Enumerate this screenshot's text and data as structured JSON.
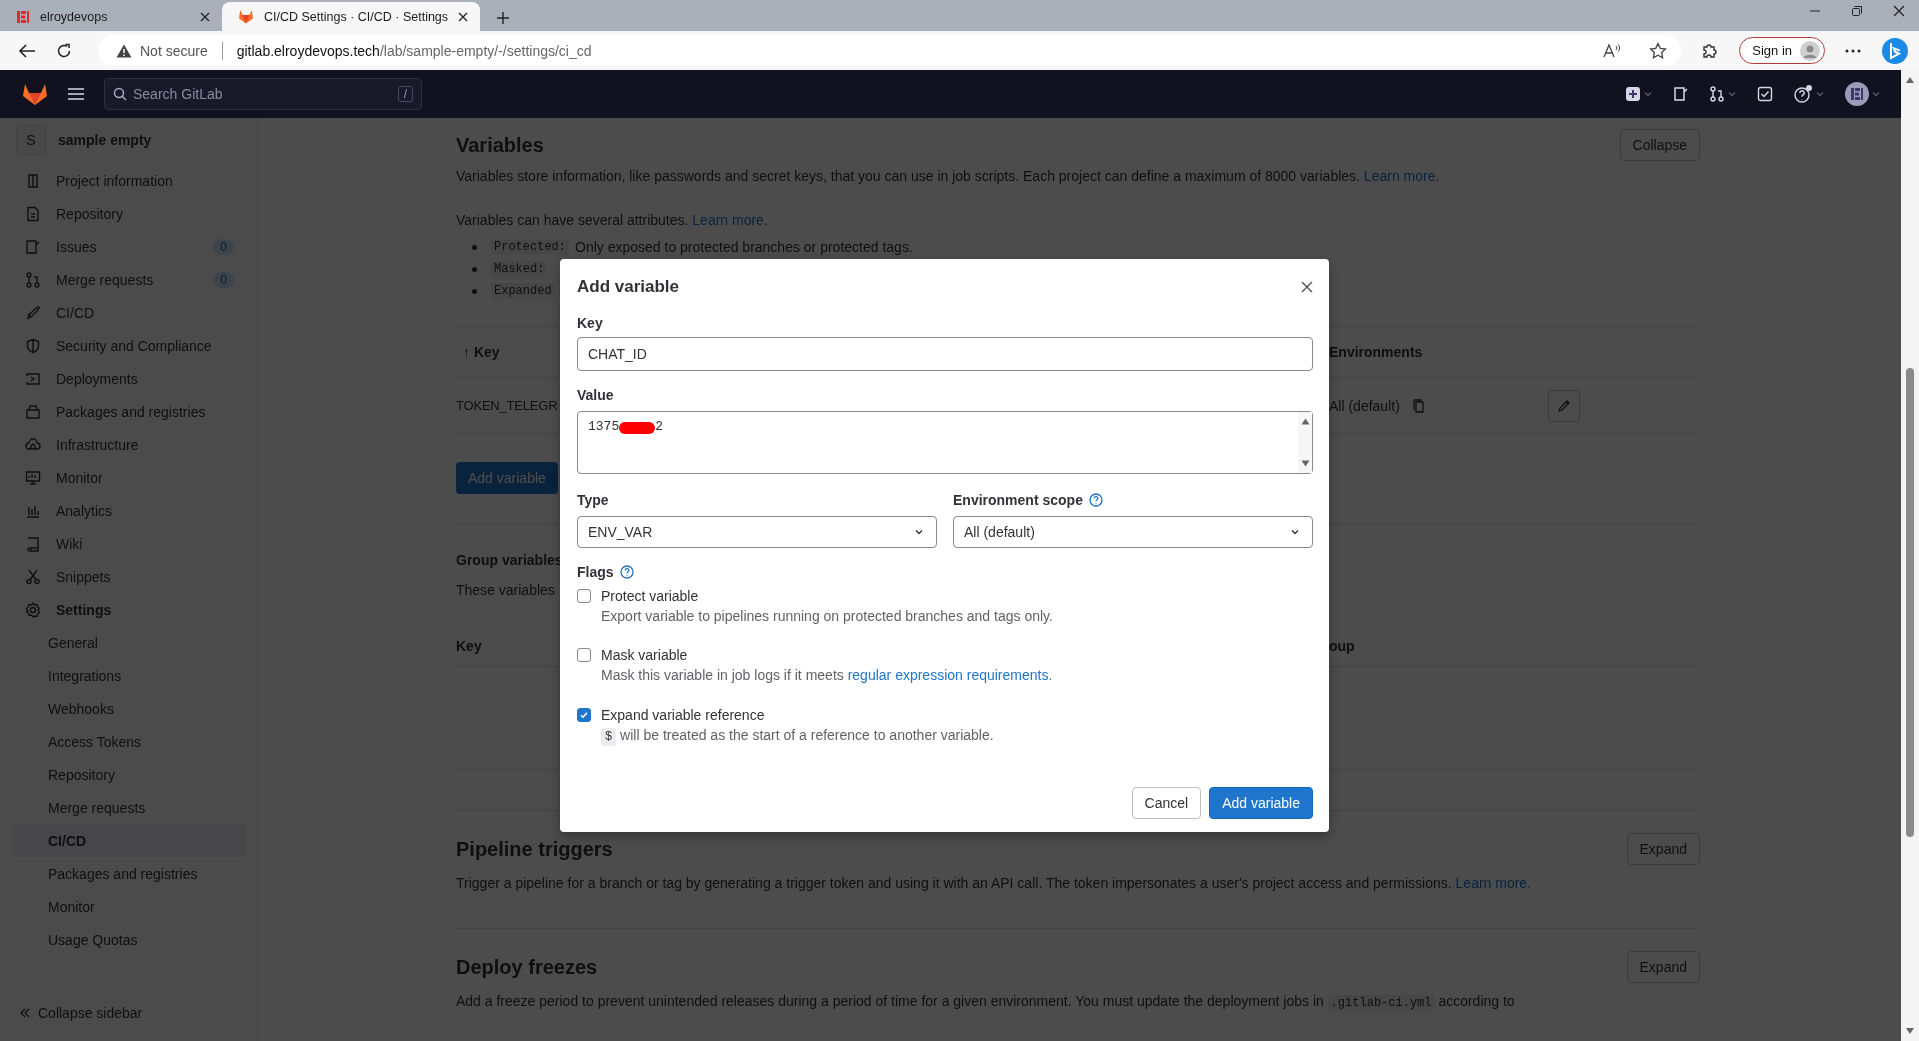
{
  "browser": {
    "tabs": [
      {
        "title": "elroydevops",
        "selected": false
      },
      {
        "title": "CI/CD Settings · CI/CD · Settings",
        "selected": true
      }
    ],
    "security": "Not secure",
    "url_host": "gitlab.elroydevops.tech",
    "url_path": "/lab/sample-empty/-/settings/ci_cd",
    "sign_in": "Sign in"
  },
  "topbar": {
    "search_placeholder": "Search GitLab",
    "search_shortcut": "/"
  },
  "sidebar": {
    "project_initial": "S",
    "project_name": "sample empty",
    "items": [
      {
        "label": "Project information",
        "expanded": false
      },
      {
        "label": "Repository",
        "expanded": false
      },
      {
        "label": "Issues",
        "count": "0",
        "expanded": false
      },
      {
        "label": "Merge requests",
        "count": "0",
        "expanded": false
      },
      {
        "label": "CI/CD",
        "expanded": false
      },
      {
        "label": "Security and Compliance",
        "expanded": false
      },
      {
        "label": "Deployments",
        "expanded": false
      },
      {
        "label": "Packages and registries",
        "expanded": false
      },
      {
        "label": "Infrastructure",
        "expanded": false
      },
      {
        "label": "Monitor",
        "expanded": false
      },
      {
        "label": "Analytics",
        "expanded": false
      },
      {
        "label": "Wiki",
        "expanded": false
      },
      {
        "label": "Snippets",
        "expanded": false
      },
      {
        "label": "Settings",
        "expanded": true,
        "children": [
          {
            "label": "General",
            "selected": false
          },
          {
            "label": "Integrations",
            "selected": false
          },
          {
            "label": "Webhooks",
            "selected": false
          },
          {
            "label": "Access Tokens",
            "selected": false
          },
          {
            "label": "Repository",
            "selected": false
          },
          {
            "label": "Merge requests",
            "selected": false
          },
          {
            "label": "CI/CD",
            "selected": true
          },
          {
            "label": "Packages and registries",
            "selected": false
          },
          {
            "label": "Monitor",
            "selected": false
          },
          {
            "label": "Usage Quotas",
            "selected": false
          }
        ]
      }
    ],
    "collapse_label": "Collapse sidebar"
  },
  "variables": {
    "title": "Variables",
    "button": "Collapse",
    "description": "Variables store information, like passwords and secret keys, that you can use in job scripts. Each project can define a maximum of 8000 variables.",
    "description_link": "Learn more.",
    "attributes_intro": "Variables can have several attributes.",
    "attributes_link": "Learn more.",
    "bullets": [
      {
        "code": "Protected:",
        "text": "Only exposed to protected branches or protected tags."
      },
      {
        "code": "Masked:"
      },
      {
        "code": "Expanded"
      }
    ],
    "columns": [
      "↑ Key",
      "Environments"
    ],
    "rows": [
      {
        "key": "TOKEN_TELEGR",
        "environment": "All (default)"
      }
    ],
    "add_button": "Add variable"
  },
  "group_variables": {
    "title": "Group variables",
    "description": "These variables",
    "columns": [
      "Key",
      "oup"
    ]
  },
  "pipeline_triggers": {
    "title": "Pipeline triggers",
    "button": "Expand",
    "description": "Trigger a pipeline for a branch or tag by generating a trigger token and using it with an API call. The token impersonates a user's project access and permissions.",
    "link": "Learn more."
  },
  "deploy_freezes": {
    "title": "Deploy freezes",
    "button": "Expand",
    "description_before": "Add a freeze period to prevent unintended releases during a period of time for a given environment. You must update the deployment jobs in",
    "code": ".gitlab-ci.yml",
    "description_after": "according to"
  },
  "modal": {
    "title": "Add variable",
    "key_label": "Key",
    "key_value": "CHAT_ID",
    "value_label": "Value",
    "value_start": "1375",
    "redacted": true,
    "value_end": "2",
    "type_label": "Type",
    "type_value": "ENV_VAR",
    "scope_label": "Environment scope",
    "scope_value": "All (default)",
    "flags_label": "Flags",
    "flags": [
      {
        "label": "Protect variable",
        "description": "Export variable to pipelines running on protected branches and tags only.",
        "checked": false
      },
      {
        "label": "Mask variable",
        "description": "Mask this variable in job logs if it meets",
        "link": "regular expression requirements.",
        "checked": false
      },
      {
        "label": "Expand variable reference",
        "code": "$",
        "description": "will be treated as the start of a reference to another variable.",
        "checked": true
      }
    ],
    "cancel": "Cancel",
    "submit": "Add variable"
  }
}
